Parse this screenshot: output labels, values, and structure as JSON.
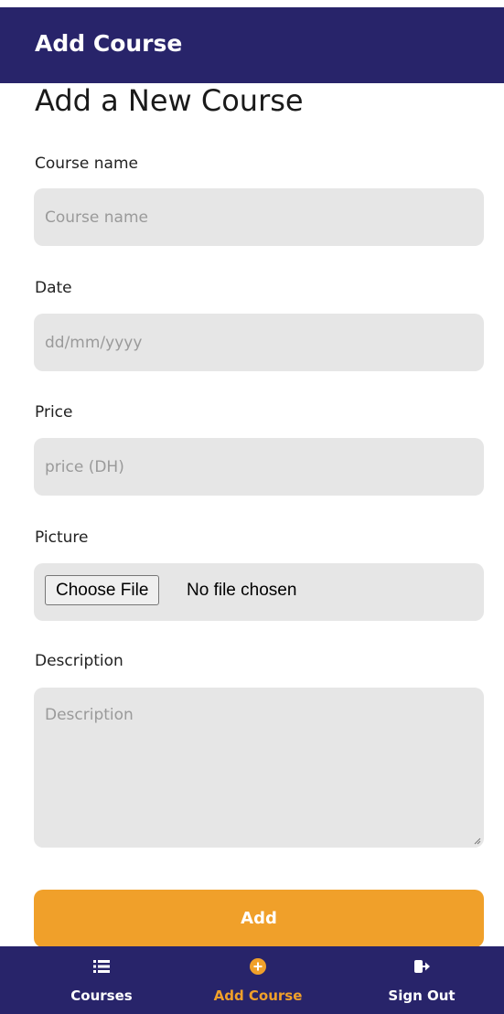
{
  "header": {
    "title": "Add Course"
  },
  "page": {
    "title": "Add a New Course"
  },
  "form": {
    "course_name": {
      "label": "Course name",
      "placeholder": "Course name",
      "value": ""
    },
    "date": {
      "label": "Date",
      "placeholder": "dd/mm/yyyy",
      "value": ""
    },
    "price": {
      "label": "Price",
      "placeholder": "price (DH)",
      "value": ""
    },
    "picture": {
      "label": "Picture",
      "button_label": "Choose File",
      "status": "No file chosen"
    },
    "description": {
      "label": "Description",
      "placeholder": "Description",
      "value": ""
    },
    "submit_label": "Add"
  },
  "nav": {
    "items": [
      {
        "label": "Courses",
        "icon": "list-icon",
        "active": false
      },
      {
        "label": "Add Course",
        "icon": "add-circle-icon",
        "active": true
      },
      {
        "label": "Sign Out",
        "icon": "sign-out-icon",
        "active": false
      }
    ]
  },
  "colors": {
    "primary": "#28246a",
    "accent": "#f0a02a",
    "field_background": "#e6e6e6"
  }
}
